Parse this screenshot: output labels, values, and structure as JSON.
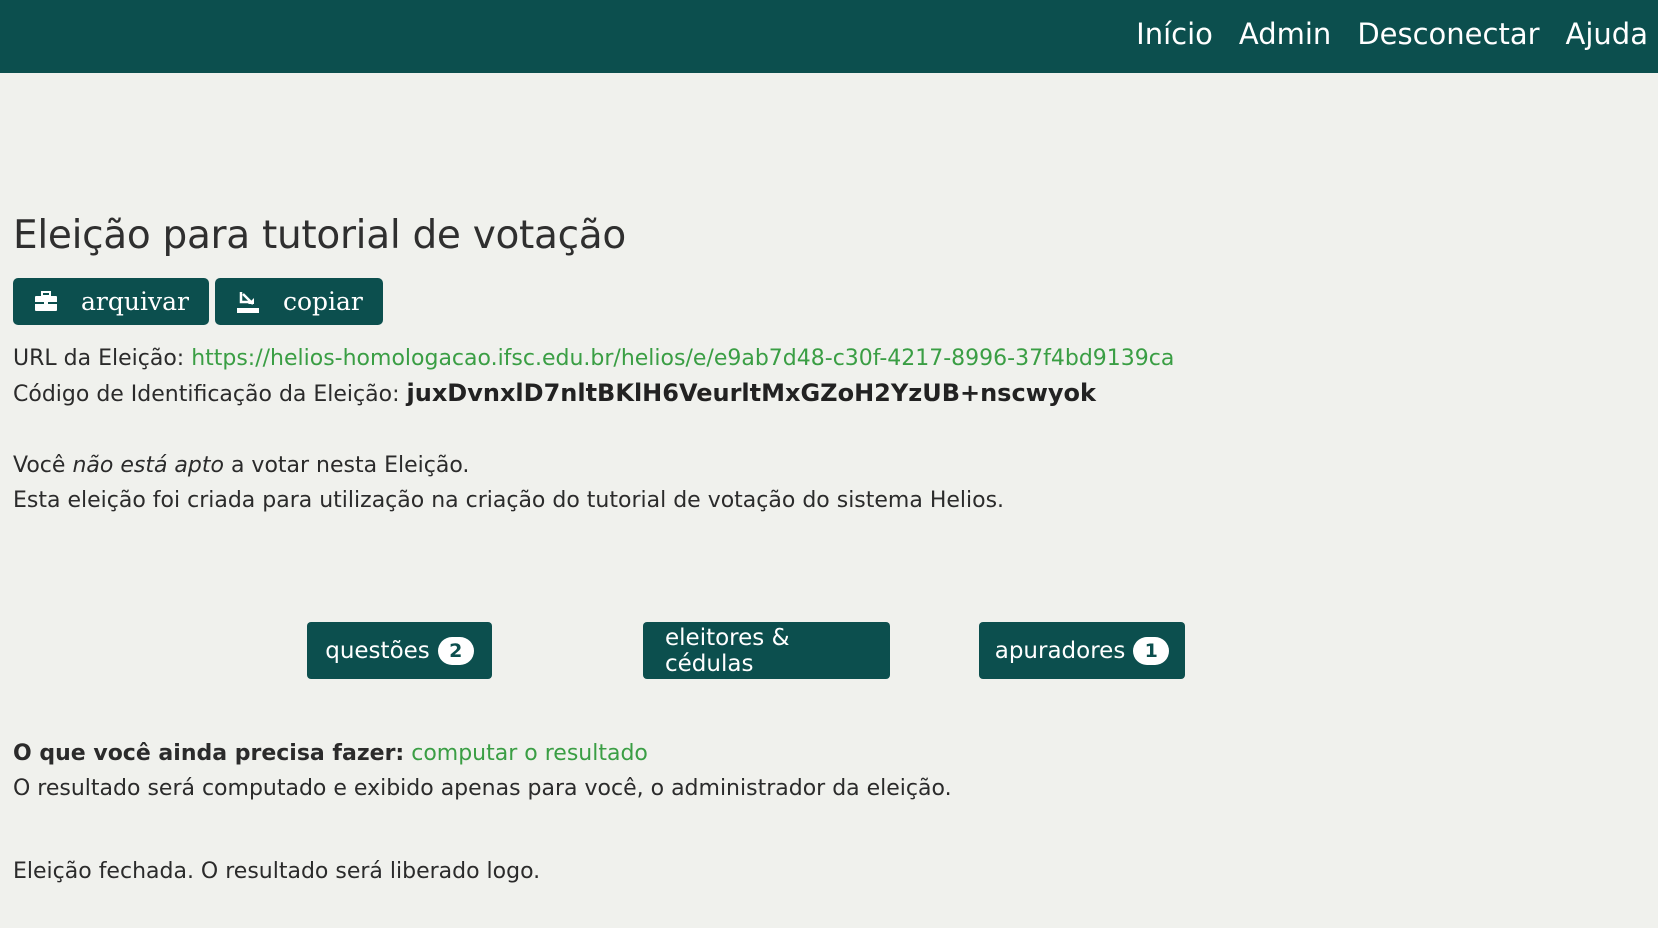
{
  "nav": {
    "items": [
      "Início",
      "Admin",
      "Desconectar",
      "Ajuda"
    ]
  },
  "election": {
    "title": "Eleição para tutorial de votação",
    "url_label": "URL da Eleição:",
    "url": "https://helios-homologacao.ifsc.edu.br/helios/e/e9ab7d48-c30f-4217-8996-37f4bd9139ca",
    "id_label": "Código de Identificação da Eleição:",
    "id_code": "juxDvnxlD7nltBKlH6VeurltMxGZoH2YzUB+nscwyok",
    "eligibility_prefix": "Você ",
    "eligibility_em": "não está apto",
    "eligibility_suffix": " a votar nesta Eleição.",
    "description": "Esta eleição foi criada para utilização na criação do tutorial de votação do sistema Helios."
  },
  "toolbar": {
    "archive_label": "arquivar",
    "copy_label": "copiar"
  },
  "sections": {
    "questions_label": "questões",
    "questions_count": "2",
    "voters_label": "eleitores & cédulas",
    "trustees_label": "apuradores",
    "trustees_count": "1"
  },
  "todo": {
    "label": "O que você ainda precisa fazer:",
    "action": "computar o resultado",
    "note": "O resultado será computado e exibido apenas para você, o administrador da eleição."
  },
  "status": {
    "closed": "Eleição fechada. O resultado será liberado logo."
  },
  "colors": {
    "primary": "#0c4f4e",
    "link": "#3a9e44",
    "background": "#f0f1ed"
  }
}
